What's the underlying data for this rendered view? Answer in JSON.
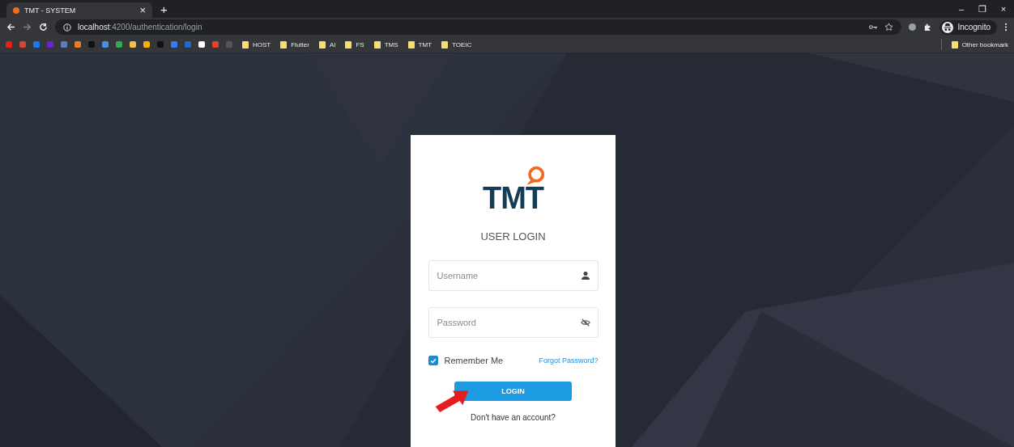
{
  "tab": {
    "title": "TMT - SYSTEM",
    "close": "×",
    "new_tab": "+"
  },
  "window_controls": {
    "minimize": "–",
    "restore": "❐",
    "close": "×"
  },
  "address_bar": {
    "host": "localhost",
    "path": ":4200/authentication/login"
  },
  "profile": {
    "label": "Incognito"
  },
  "bookmarks": {
    "favicons": [
      {
        "color": "#e62117"
      },
      {
        "color": "#d44638"
      },
      {
        "color": "#1877f2"
      },
      {
        "color": "#6b21d6"
      },
      {
        "color": "#5b7fb8"
      },
      {
        "color": "#f07d22"
      },
      {
        "color": "#111111"
      },
      {
        "color": "#4a8fe0"
      },
      {
        "color": "#34a853"
      },
      {
        "color": "#f4c04a"
      },
      {
        "color": "#f6b400"
      },
      {
        "color": "#111111"
      },
      {
        "color": "#2f80ed"
      },
      {
        "color": "#2366d1"
      },
      {
        "color": "#ffffff"
      },
      {
        "color": "#e24329"
      },
      {
        "color": "#555555"
      }
    ],
    "folders": [
      "HOST",
      "Flutter",
      "AI",
      "FS",
      "TMS",
      "TMT",
      "TOEIC"
    ],
    "other": "Other bookmark"
  },
  "login": {
    "logo": "TMT",
    "heading": "USER LOGIN",
    "username": {
      "placeholder": "Username"
    },
    "password": {
      "placeholder": "Password"
    },
    "remember": {
      "label": "Remember Me",
      "checked": true
    },
    "forgot": "Forgot Password?",
    "submit": "LOGIN",
    "signup_prompt": "Don't have an account?"
  }
}
